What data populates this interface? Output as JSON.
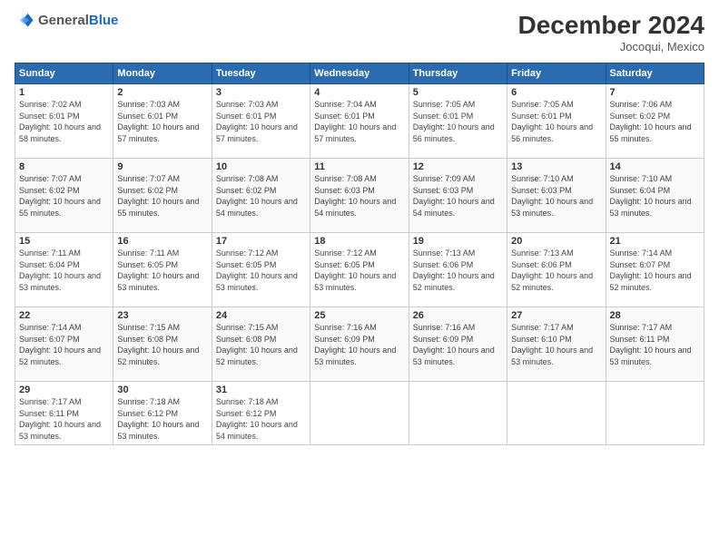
{
  "header": {
    "logo_line1": "General",
    "logo_line2": "Blue",
    "month_title": "December 2024",
    "location": "Jocoqui, Mexico"
  },
  "weekdays": [
    "Sunday",
    "Monday",
    "Tuesday",
    "Wednesday",
    "Thursday",
    "Friday",
    "Saturday"
  ],
  "weeks": [
    [
      {
        "day": "1",
        "sunrise": "7:02 AM",
        "sunset": "6:01 PM",
        "daylight": "10 hours and 58 minutes."
      },
      {
        "day": "2",
        "sunrise": "7:03 AM",
        "sunset": "6:01 PM",
        "daylight": "10 hours and 57 minutes."
      },
      {
        "day": "3",
        "sunrise": "7:03 AM",
        "sunset": "6:01 PM",
        "daylight": "10 hours and 57 minutes."
      },
      {
        "day": "4",
        "sunrise": "7:04 AM",
        "sunset": "6:01 PM",
        "daylight": "10 hours and 57 minutes."
      },
      {
        "day": "5",
        "sunrise": "7:05 AM",
        "sunset": "6:01 PM",
        "daylight": "10 hours and 56 minutes."
      },
      {
        "day": "6",
        "sunrise": "7:05 AM",
        "sunset": "6:01 PM",
        "daylight": "10 hours and 56 minutes."
      },
      {
        "day": "7",
        "sunrise": "7:06 AM",
        "sunset": "6:02 PM",
        "daylight": "10 hours and 55 minutes."
      }
    ],
    [
      {
        "day": "8",
        "sunrise": "7:07 AM",
        "sunset": "6:02 PM",
        "daylight": "10 hours and 55 minutes."
      },
      {
        "day": "9",
        "sunrise": "7:07 AM",
        "sunset": "6:02 PM",
        "daylight": "10 hours and 55 minutes."
      },
      {
        "day": "10",
        "sunrise": "7:08 AM",
        "sunset": "6:02 PM",
        "daylight": "10 hours and 54 minutes."
      },
      {
        "day": "11",
        "sunrise": "7:08 AM",
        "sunset": "6:03 PM",
        "daylight": "10 hours and 54 minutes."
      },
      {
        "day": "12",
        "sunrise": "7:09 AM",
        "sunset": "6:03 PM",
        "daylight": "10 hours and 54 minutes."
      },
      {
        "day": "13",
        "sunrise": "7:10 AM",
        "sunset": "6:03 PM",
        "daylight": "10 hours and 53 minutes."
      },
      {
        "day": "14",
        "sunrise": "7:10 AM",
        "sunset": "6:04 PM",
        "daylight": "10 hours and 53 minutes."
      }
    ],
    [
      {
        "day": "15",
        "sunrise": "7:11 AM",
        "sunset": "6:04 PM",
        "daylight": "10 hours and 53 minutes."
      },
      {
        "day": "16",
        "sunrise": "7:11 AM",
        "sunset": "6:05 PM",
        "daylight": "10 hours and 53 minutes."
      },
      {
        "day": "17",
        "sunrise": "7:12 AM",
        "sunset": "6:05 PM",
        "daylight": "10 hours and 53 minutes."
      },
      {
        "day": "18",
        "sunrise": "7:12 AM",
        "sunset": "6:05 PM",
        "daylight": "10 hours and 53 minutes."
      },
      {
        "day": "19",
        "sunrise": "7:13 AM",
        "sunset": "6:06 PM",
        "daylight": "10 hours and 52 minutes."
      },
      {
        "day": "20",
        "sunrise": "7:13 AM",
        "sunset": "6:06 PM",
        "daylight": "10 hours and 52 minutes."
      },
      {
        "day": "21",
        "sunrise": "7:14 AM",
        "sunset": "6:07 PM",
        "daylight": "10 hours and 52 minutes."
      }
    ],
    [
      {
        "day": "22",
        "sunrise": "7:14 AM",
        "sunset": "6:07 PM",
        "daylight": "10 hours and 52 minutes."
      },
      {
        "day": "23",
        "sunrise": "7:15 AM",
        "sunset": "6:08 PM",
        "daylight": "10 hours and 52 minutes."
      },
      {
        "day": "24",
        "sunrise": "7:15 AM",
        "sunset": "6:08 PM",
        "daylight": "10 hours and 52 minutes."
      },
      {
        "day": "25",
        "sunrise": "7:16 AM",
        "sunset": "6:09 PM",
        "daylight": "10 hours and 53 minutes."
      },
      {
        "day": "26",
        "sunrise": "7:16 AM",
        "sunset": "6:09 PM",
        "daylight": "10 hours and 53 minutes."
      },
      {
        "day": "27",
        "sunrise": "7:17 AM",
        "sunset": "6:10 PM",
        "daylight": "10 hours and 53 minutes."
      },
      {
        "day": "28",
        "sunrise": "7:17 AM",
        "sunset": "6:11 PM",
        "daylight": "10 hours and 53 minutes."
      }
    ],
    [
      {
        "day": "29",
        "sunrise": "7:17 AM",
        "sunset": "6:11 PM",
        "daylight": "10 hours and 53 minutes."
      },
      {
        "day": "30",
        "sunrise": "7:18 AM",
        "sunset": "6:12 PM",
        "daylight": "10 hours and 53 minutes."
      },
      {
        "day": "31",
        "sunrise": "7:18 AM",
        "sunset": "6:12 PM",
        "daylight": "10 hours and 54 minutes."
      },
      null,
      null,
      null,
      null
    ]
  ]
}
